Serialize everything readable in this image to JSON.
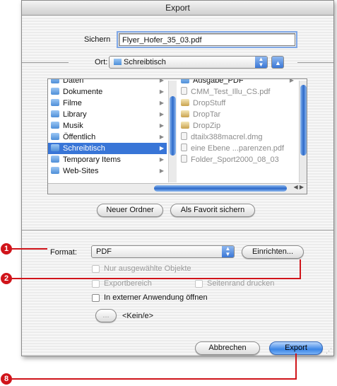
{
  "window": {
    "title": "Export"
  },
  "save": {
    "label": "Sichern",
    "filename": "Flyer_Hofer_35_03.pdf"
  },
  "location": {
    "label": "Ort:",
    "value": "Schreibtisch"
  },
  "browser": {
    "left_column": [
      {
        "label": "Daten",
        "icon": "folder-icon"
      },
      {
        "label": "Dokumente",
        "icon": "folder-icon"
      },
      {
        "label": "Filme",
        "icon": "folder-icon"
      },
      {
        "label": "Library",
        "icon": "folder-icon"
      },
      {
        "label": "Musik",
        "icon": "folder-icon"
      },
      {
        "label": "Öffentlich",
        "icon": "folder-icon"
      },
      {
        "label": "Schreibtisch",
        "icon": "folder-icon",
        "selected": true
      },
      {
        "label": "Temporary Items",
        "icon": "folder-icon"
      },
      {
        "label": "Web-Sites",
        "icon": "folder-icon"
      }
    ],
    "right_column": [
      {
        "label": "Ausgabe_PDF",
        "icon": "folder-icon",
        "enabled": true
      },
      {
        "label": "CMM_Test_Illu_CS.pdf",
        "icon": "document-icon",
        "enabled": false
      },
      {
        "label": "DropStuff",
        "icon": "application-icon",
        "enabled": false
      },
      {
        "label": "DropTar",
        "icon": "application-icon",
        "enabled": false
      },
      {
        "label": "DropZip",
        "icon": "application-icon",
        "enabled": false
      },
      {
        "label": "dtailx388macrel.dmg",
        "icon": "document-icon",
        "enabled": false
      },
      {
        "label": "eine Ebene ...parenzen.pdf",
        "icon": "document-icon",
        "enabled": false
      },
      {
        "label": "Folder_Sport2000_08_03",
        "icon": "document-icon",
        "enabled": false
      }
    ]
  },
  "buttons": {
    "new_folder": "Neuer Ordner",
    "add_favorite": "Als Favorit sichern",
    "setup": "Einrichten...",
    "choose": "...",
    "cancel": "Abbrechen",
    "export": "Export"
  },
  "format": {
    "label": "Format:",
    "value": "PDF"
  },
  "options": {
    "selected_only": "Nur ausgewählte Objekte",
    "export_area": "Exportbereich",
    "page_margin": "Seitenrand drucken",
    "open_external": "In externer Anwendung öffnen",
    "app_none": "<Kein/e>"
  },
  "callouts": {
    "one": "1",
    "two": "2",
    "eight": "8"
  },
  "colors": {
    "accent": "#3875d7",
    "callout": "#d0141a"
  }
}
